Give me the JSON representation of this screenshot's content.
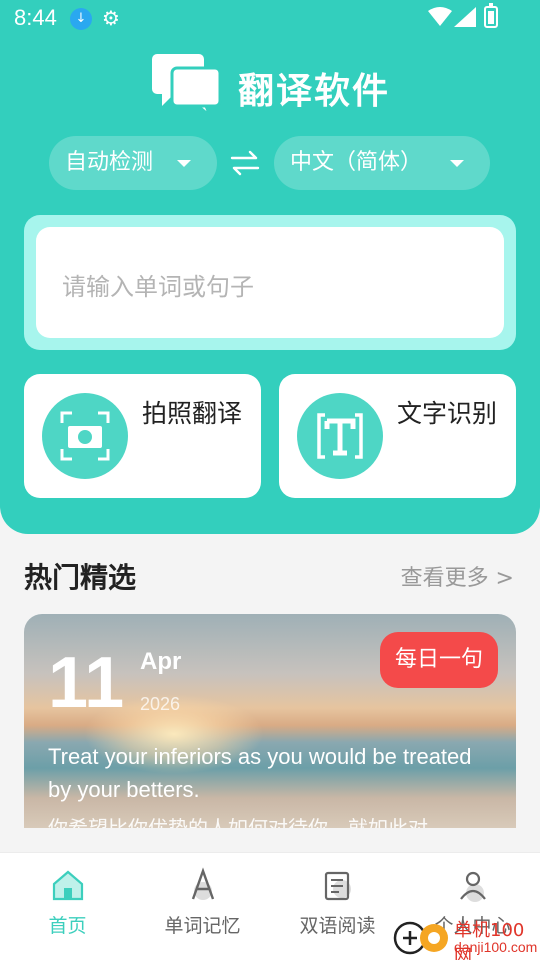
{
  "status_bar": {
    "time": "8:44"
  },
  "app": {
    "title": "翻译软件"
  },
  "languages": {
    "source": "自动检测",
    "target": "中文（简体）"
  },
  "input": {
    "placeholder": "请输入单词或句子"
  },
  "tools": [
    {
      "label": "拍照翻译",
      "icon": "camera-scan-icon"
    },
    {
      "label": "文字识别",
      "icon": "text-recognition-icon"
    }
  ],
  "section": {
    "title": "热门精选",
    "more": "查看更多 >"
  },
  "daily_card": {
    "day": "11",
    "month": "Apr",
    "year": "2026",
    "badge": "每日一句",
    "quote_en": "Treat your inferiors as you would be treated by your betters.",
    "quote_cn": "你希望比你优势的人如何对待你，就如此对"
  },
  "tabbar": [
    {
      "label": "首页",
      "icon": "home-icon",
      "active": true
    },
    {
      "label": "单词记忆",
      "icon": "word-memory-icon",
      "active": false
    },
    {
      "label": "双语阅读",
      "icon": "reading-icon",
      "active": false
    },
    {
      "label": "个人中心",
      "icon": "profile-icon",
      "active": false
    }
  ],
  "watermark": {
    "line1": "单机100网",
    "line2": "danji100.com"
  },
  "colors": {
    "primary": "#33cfbd",
    "accent_red": "#f44a4a",
    "tab_active": "#3ccfbd"
  }
}
